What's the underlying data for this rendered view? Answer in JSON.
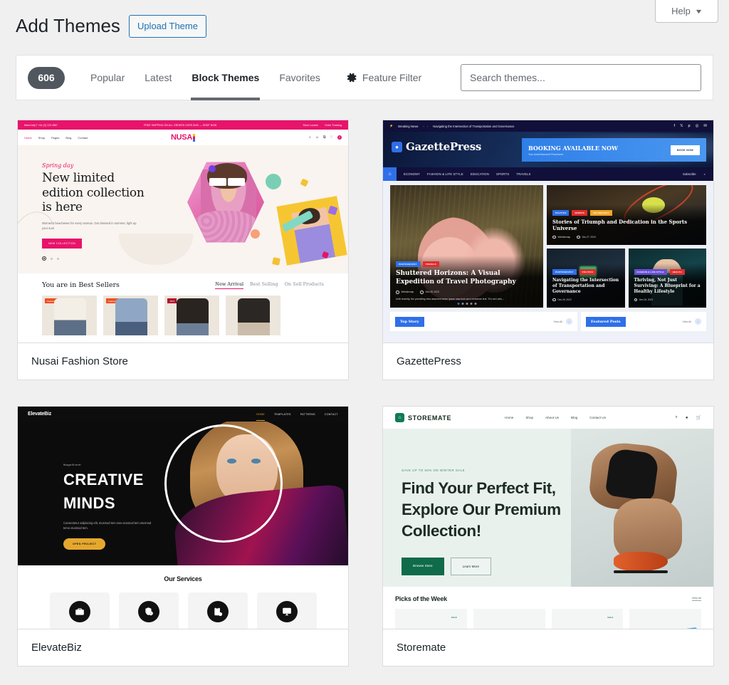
{
  "header": {
    "page_title": "Add Themes",
    "upload_button": "Upload Theme",
    "help_button": "Help",
    "help_caret": "▼"
  },
  "filter_bar": {
    "count": "606",
    "tabs": [
      {
        "label": "Popular",
        "active": false
      },
      {
        "label": "Latest",
        "active": false
      },
      {
        "label": "Block Themes",
        "active": true
      },
      {
        "label": "Favorites",
        "active": false
      }
    ],
    "feature_filter": "Feature Filter",
    "feature_filter_icon": "gear-icon",
    "search_placeholder": "Search themes...",
    "search_value": ""
  },
  "themes": [
    {
      "name": "Nusai Fashion Store",
      "preview": {
        "topbar": {
          "phone": "Need help? +44 (0) 123 4567",
          "promo": "FREE SHIPPING ON ALL ORDERS OVER $100 — SHOP NOW",
          "store_locator": "Store Locator",
          "order_tracking": "Order Tracking"
        },
        "nav": [
          "Home",
          "Shop",
          "Pages",
          "Blog",
          "Contact"
        ],
        "logo": "NUSA",
        "cart_count": "0",
        "hero": {
          "script": "Spring day",
          "headline": "New limited edition collection is here",
          "subtext": "Women's beachwear for every woman. Get dressed in summer, light up your sun!",
          "cta": "NEW COLLECTION"
        },
        "best": {
          "title": "You are in Best Sellers",
          "tabs": [
            "New Arrival",
            "Best Selling",
            "On Sell Products"
          ],
          "active_tab": "New Arrival",
          "product_tags": [
            "Featured",
            "Featured",
            "-50%",
            ""
          ]
        }
      }
    },
    {
      "name": "GazettePress",
      "preview": {
        "breaking": {
          "label": "Breaking News",
          "headline": "Navigating the Intersection of Transportation and Governance"
        },
        "brand": "GazettePress",
        "ad": {
          "headline": "BOOKING AVAILABLE NOW",
          "subtext": "Your Advertisement Placement",
          "button": "BOOK NOW"
        },
        "nav": [
          "ECONOMY",
          "FASHION & LIFE STYLE",
          "EDUCATION",
          "SPORTS",
          "TRAVELS"
        ],
        "nav_right": "Subscribe",
        "featured_article": {
          "tags": [
            "PHOTOGRAPHY",
            "TRAVELS"
          ],
          "title": "Shuttered Horizons: A Visual Expedition of Travel Photography",
          "author": "Websitemap",
          "date": "Dec 28, 2023",
          "excerpt": "Until recently, the prevailing view assumed lorem ipsum was born as a nonsense text. \"It's not Latin,..."
        },
        "side_articles": [
          {
            "tags": [
              "POLITICS",
              "SPORTS",
              "TECHNOLOGY"
            ],
            "title": "Stories of Triumph and Dedication in the Sports Universe",
            "author": "Websitemap",
            "date": "Dec 27, 2023"
          },
          {
            "tags": [
              "PHOTOGRAPHY",
              "POLITICS"
            ],
            "title": "Navigating the Intersection of Transportation and Governance",
            "date": "Dec 26, 2023"
          },
          {
            "tags": [
              "FASHION & LIFE STYLE",
              "HEALTH"
            ],
            "title": "Thriving, Not Just Surviving: A Blueprint for a Healthy Lifestyle",
            "date": "Dec 26, 2023"
          }
        ],
        "sections": [
          {
            "label": "Top Story",
            "view_all": "View All"
          },
          {
            "label": "Featured Posts",
            "view_all": "View All"
          }
        ]
      }
    },
    {
      "name": "ElevateBiz",
      "preview": {
        "logo": "ElevateBiz",
        "nav": [
          "HOME",
          "TEMPLATES",
          "PATTERNS",
          "CONTACT"
        ],
        "active_nav": "HOME",
        "hero": {
          "kicker": "Magnificent",
          "headline_line1": "CREATIVE",
          "headline_line2": "MINDS",
          "subtext": "Consectetur adipiscing elit, eiusmod tem eius eiusmod tem eiusmod temo eiusmod tem.",
          "cta": "OPEN PROJECT"
        },
        "services": {
          "title": "Our Services",
          "icons": [
            "briefcase-icon",
            "shield-check-icon",
            "clipboard-icon",
            "presentation-icon"
          ]
        }
      }
    },
    {
      "name": "Storemate",
      "preview": {
        "logo": "STOREMATE",
        "nav": [
          "Home",
          "Shop",
          "About Us",
          "Blog",
          "Contact Us"
        ],
        "icons": [
          "search-icon",
          "account-icon",
          "cart-icon"
        ],
        "hero": {
          "kicker": "SAVE UP TO 50% ON WINTER SALE",
          "headline": "Find Your Perfect Fit, Explore Our Premium Collection!",
          "primary_button": "Browse Store",
          "secondary_button": "Learn More"
        },
        "picks": {
          "title": "Picks of the Week",
          "view_all": "View All",
          "badges": [
            "SALE",
            "",
            "SALE",
            ""
          ]
        }
      }
    }
  ],
  "colors": {
    "admin_bg": "#f0f0f1",
    "accent_blue": "#2271b1",
    "badge_gray": "#50575e",
    "nusai_pink": "#e8136a",
    "gazette_blue": "#2f6fe8",
    "elevate_gold": "#e5a82e",
    "storemate_green": "#0f6b4a"
  }
}
